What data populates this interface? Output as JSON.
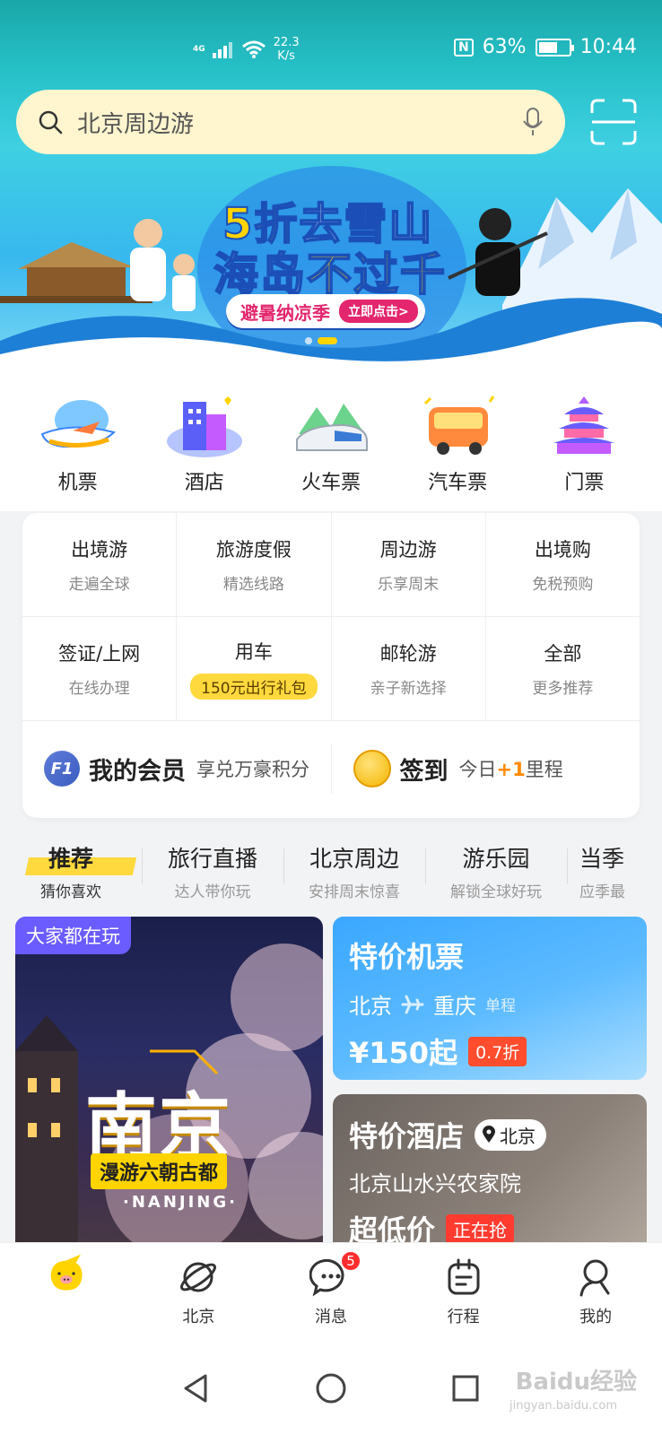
{
  "status_bar": {
    "network": "4G",
    "speed_value": "22.3",
    "speed_unit": "K/s",
    "nfc": "N",
    "battery": "63%",
    "battery_level": 0.63,
    "time": "10:44"
  },
  "search": {
    "query": "北京周边游"
  },
  "banner": {
    "title_part1": "5折",
    "title_part2": "去雪山",
    "title2_part1": "海岛",
    "title2_part2": "不过千",
    "pill_text": "避暑纳凉季",
    "pill_button": "立即点击>",
    "active_index": 1,
    "count": 2
  },
  "main_categories": [
    {
      "label": "机票",
      "icon": "plane-icon"
    },
    {
      "label": "酒店",
      "icon": "hotel-icon"
    },
    {
      "label": "火车票",
      "icon": "train-icon"
    },
    {
      "label": "汽车票",
      "icon": "bus-icon"
    },
    {
      "label": "门票",
      "icon": "temple-icon"
    }
  ],
  "grid": {
    "row1": [
      {
        "title": "出境游",
        "sub": "走遍全球"
      },
      {
        "title": "旅游度假",
        "sub": "精选线路"
      },
      {
        "title": "周边游",
        "sub": "乐享周末"
      },
      {
        "title": "出境购",
        "sub": "免税预购"
      }
    ],
    "row2": [
      {
        "title": "签证/上网",
        "sub": "在线办理"
      },
      {
        "title": "用车",
        "sub": "150元出行礼包"
      },
      {
        "title": "邮轮游",
        "sub": "亲子新选择"
      },
      {
        "title": "全部",
        "sub": "更多推荐"
      }
    ],
    "member": {
      "badge": "F1",
      "title": "我的会员",
      "sub": "享兑万豪积分"
    },
    "checkin": {
      "title": "签到",
      "sub_prefix": "今日",
      "sub_highlight": "+1",
      "sub_suffix": "里程"
    }
  },
  "feed_tabs": [
    {
      "title": "推荐",
      "sub": "猜你喜欢"
    },
    {
      "title": "旅行直播",
      "sub": "达人带你玩"
    },
    {
      "title": "北京周边",
      "sub": "安排周末惊喜"
    },
    {
      "title": "游乐园",
      "sub": "解锁全球好玩"
    },
    {
      "title": "当季",
      "sub": "应季最"
    }
  ],
  "card_nanjing": {
    "tag": "大家都在玩",
    "title": "南京",
    "subtitle": "漫游六朝古都",
    "english": "·NANJING·"
  },
  "card_flight": {
    "title": "特价机票",
    "from": "北京",
    "to": "重庆",
    "trip": "单程",
    "price": "¥150起",
    "discount": "0.7折"
  },
  "card_hotel": {
    "title": "特价酒店",
    "location": "北京",
    "name": "北京山水兴农家院",
    "price": "超低价",
    "badge": "正在抢"
  },
  "tabbar": {
    "items": [
      {
        "label": "",
        "icon": "home-mascot-icon"
      },
      {
        "label": "北京",
        "icon": "planet-icon"
      },
      {
        "label": "消息",
        "icon": "message-icon",
        "badge": "5"
      },
      {
        "label": "行程",
        "icon": "itinerary-icon"
      },
      {
        "label": "我的",
        "icon": "profile-icon"
      }
    ]
  },
  "watermark": {
    "brand": "Baidu经验",
    "url": "jingyan.baidu.com"
  }
}
